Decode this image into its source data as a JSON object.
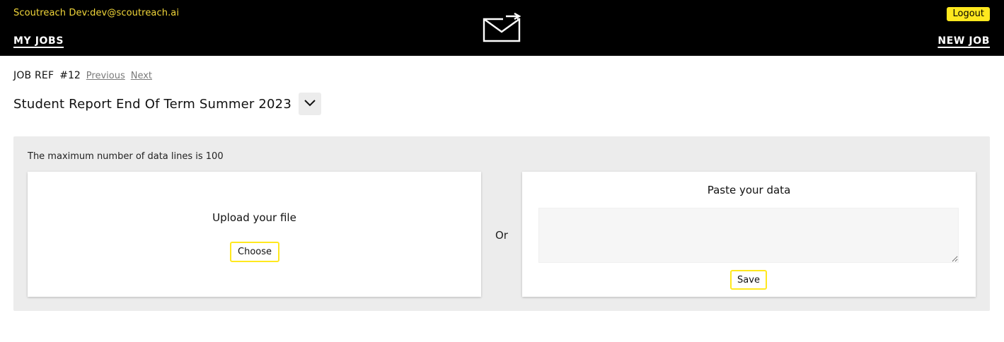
{
  "header": {
    "user_label": "Scoutreach Dev:dev@scoutreach.ai",
    "logout_label": "Logout",
    "nav_my_jobs": "MY JOBS",
    "nav_new_job": "NEW JOB",
    "logo_icon": "envelope-send-icon",
    "accent_color": "#ffe81e"
  },
  "job": {
    "ref_label": "JOB REF",
    "ref_number": "#12",
    "previous_label": "Previous",
    "next_label": "Next",
    "title": "Student Report End Of Term Summer 2023",
    "dropdown_icon": "chevron-down-icon"
  },
  "data_panel": {
    "max_lines_text": "The maximum number of data lines is 100",
    "upload_title": "Upload your file",
    "choose_label": "Choose",
    "or_label": "Or",
    "paste_title": "Paste your data",
    "paste_value": "",
    "save_label": "Save"
  }
}
